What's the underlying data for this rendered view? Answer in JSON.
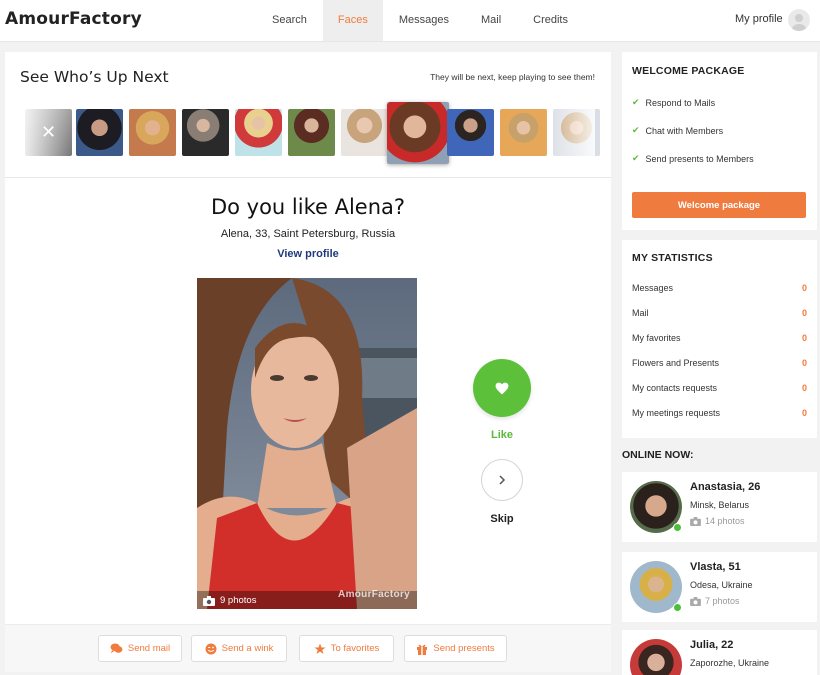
{
  "header": {
    "logo": "AmourFactory",
    "nav": [
      "Search",
      "Faces",
      "Messages",
      "Mail",
      "Credits"
    ],
    "active_nav": "Faces",
    "my_profile": "My profile"
  },
  "up_next": {
    "title": "See Who’s Up Next",
    "note": "They will be next, keep playing to see them!",
    "skip_icon_glyph": "✕"
  },
  "profile": {
    "question": "Do you like Alena?",
    "info": "Alena, 33, Saint Petersburg, Russia",
    "view_profile": "View profile",
    "photo_count": "9 photos",
    "watermark": "AmourFactory"
  },
  "controls": {
    "like": "Like",
    "skip": "Skip"
  },
  "actions": {
    "send_mail": "Send mail",
    "send_wink": "Send a wink",
    "favorites": "To favorites",
    "presents": "Send presents"
  },
  "welcome": {
    "title": "WELCOME PACKAGE",
    "items": [
      "Respond to Mails",
      "Chat with Members",
      "Send presents to Members"
    ],
    "button": "Welcome package"
  },
  "stats": {
    "title": "MY STATISTICS",
    "rows": [
      {
        "label": "Messages",
        "value": "0"
      },
      {
        "label": "Mail",
        "value": "0"
      },
      {
        "label": "My favorites",
        "value": "0"
      },
      {
        "label": "Flowers and Presents",
        "value": "0"
      },
      {
        "label": "My contacts requests",
        "value": "0"
      },
      {
        "label": "My meetings requests",
        "value": "0"
      }
    ]
  },
  "online": {
    "title": "ONLINE NOW:",
    "members": [
      {
        "name": "Anastasia, 26",
        "city": "Minsk, Belarus",
        "photos": "14 photos"
      },
      {
        "name": "Vlasta, 51",
        "city": "Odesa, Ukraine",
        "photos": "7 photos"
      },
      {
        "name": "Julia, 22",
        "city": "Zaporozhe, Ukraine",
        "photos": ""
      }
    ]
  },
  "colors": {
    "accent": "#f07b3f",
    "like_green": "#5cc03a",
    "link_blue": "#1f3a7a",
    "online_dot": "#4bbf3a"
  }
}
